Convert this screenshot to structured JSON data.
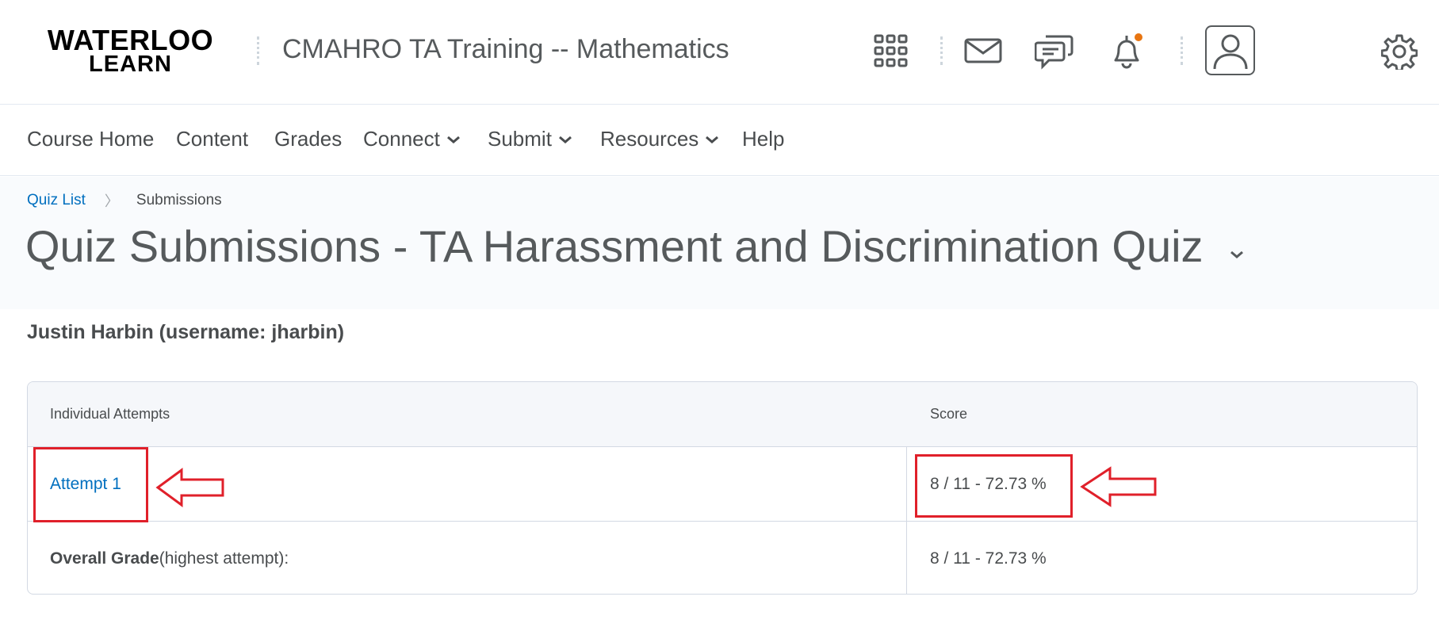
{
  "header": {
    "logo_line1": "WATERLOO",
    "logo_line2": "LEARN",
    "course_title": "CMAHRO TA Training -- Mathematics",
    "icons": [
      "apps-grid-icon",
      "mail-icon",
      "chat-icon",
      "bell-icon",
      "avatar-icon",
      "gear-icon"
    ],
    "notification_color": "#e87511"
  },
  "nav": {
    "items": [
      {
        "label": "Course Home",
        "dropdown": false
      },
      {
        "label": "Content",
        "dropdown": false
      },
      {
        "label": "Grades",
        "dropdown": false
      },
      {
        "label": "Connect",
        "dropdown": true
      },
      {
        "label": "Submit",
        "dropdown": true
      },
      {
        "label": "Resources",
        "dropdown": true
      },
      {
        "label": "Help",
        "dropdown": false
      }
    ]
  },
  "breadcrumb": {
    "link": "Quiz List",
    "current": "Submissions"
  },
  "page": {
    "title": "Quiz Submissions - TA Harassment and Discrimination Quiz",
    "user": "Justin Harbin (username: jharbin)"
  },
  "table": {
    "headers": [
      "Individual Attempts",
      "Score"
    ],
    "attempt": {
      "label": "Attempt 1",
      "score": "8 / 11 - 72.73 %"
    },
    "overall": {
      "label_bold": "Overall Grade",
      "label_rest": " (highest attempt):",
      "score": "8 / 11 - 72.73 %"
    }
  },
  "colors": {
    "link": "#006fbf",
    "annotation": "#e0202a"
  }
}
